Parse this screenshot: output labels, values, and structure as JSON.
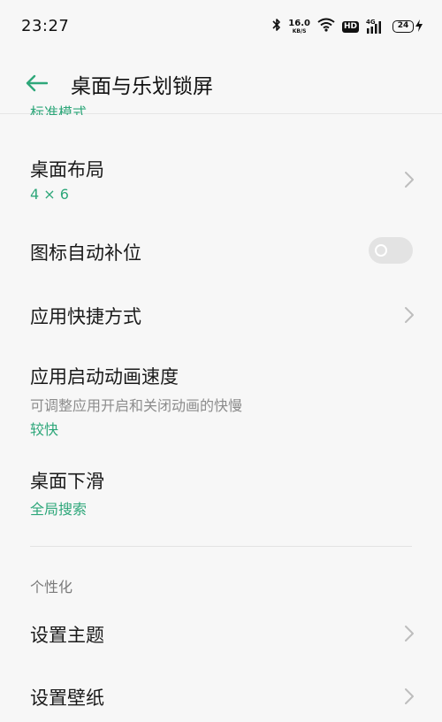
{
  "status_bar": {
    "time": "23:27",
    "net_speed_value": "16.0",
    "net_speed_unit": "KB/S",
    "hd_label": "HD",
    "network_type": "4G",
    "battery_level": "24"
  },
  "header": {
    "title": "桌面与乐划锁屏"
  },
  "clipped_item": {
    "value": "标准模式"
  },
  "settings": {
    "desktop_layout": {
      "title": "桌面布局",
      "value": "4 × 6"
    },
    "icon_auto_fill": {
      "title": "图标自动补位",
      "enabled": false
    },
    "app_shortcuts": {
      "title": "应用快捷方式"
    },
    "app_launch_anim": {
      "title": "应用启动动画速度",
      "subtitle": "可调整应用开启和关闭动画的快慢",
      "value": "较快"
    },
    "desktop_swipe_down": {
      "title": "桌面下滑",
      "value": "全局搜索"
    }
  },
  "personalization": {
    "section_title": "个性化",
    "set_theme": {
      "title": "设置主题"
    },
    "set_wallpaper": {
      "title": "设置壁纸"
    }
  },
  "colors": {
    "accent": "#2ea77a",
    "background": "#f7f7f7",
    "secondary_text": "#8c8c8c"
  }
}
